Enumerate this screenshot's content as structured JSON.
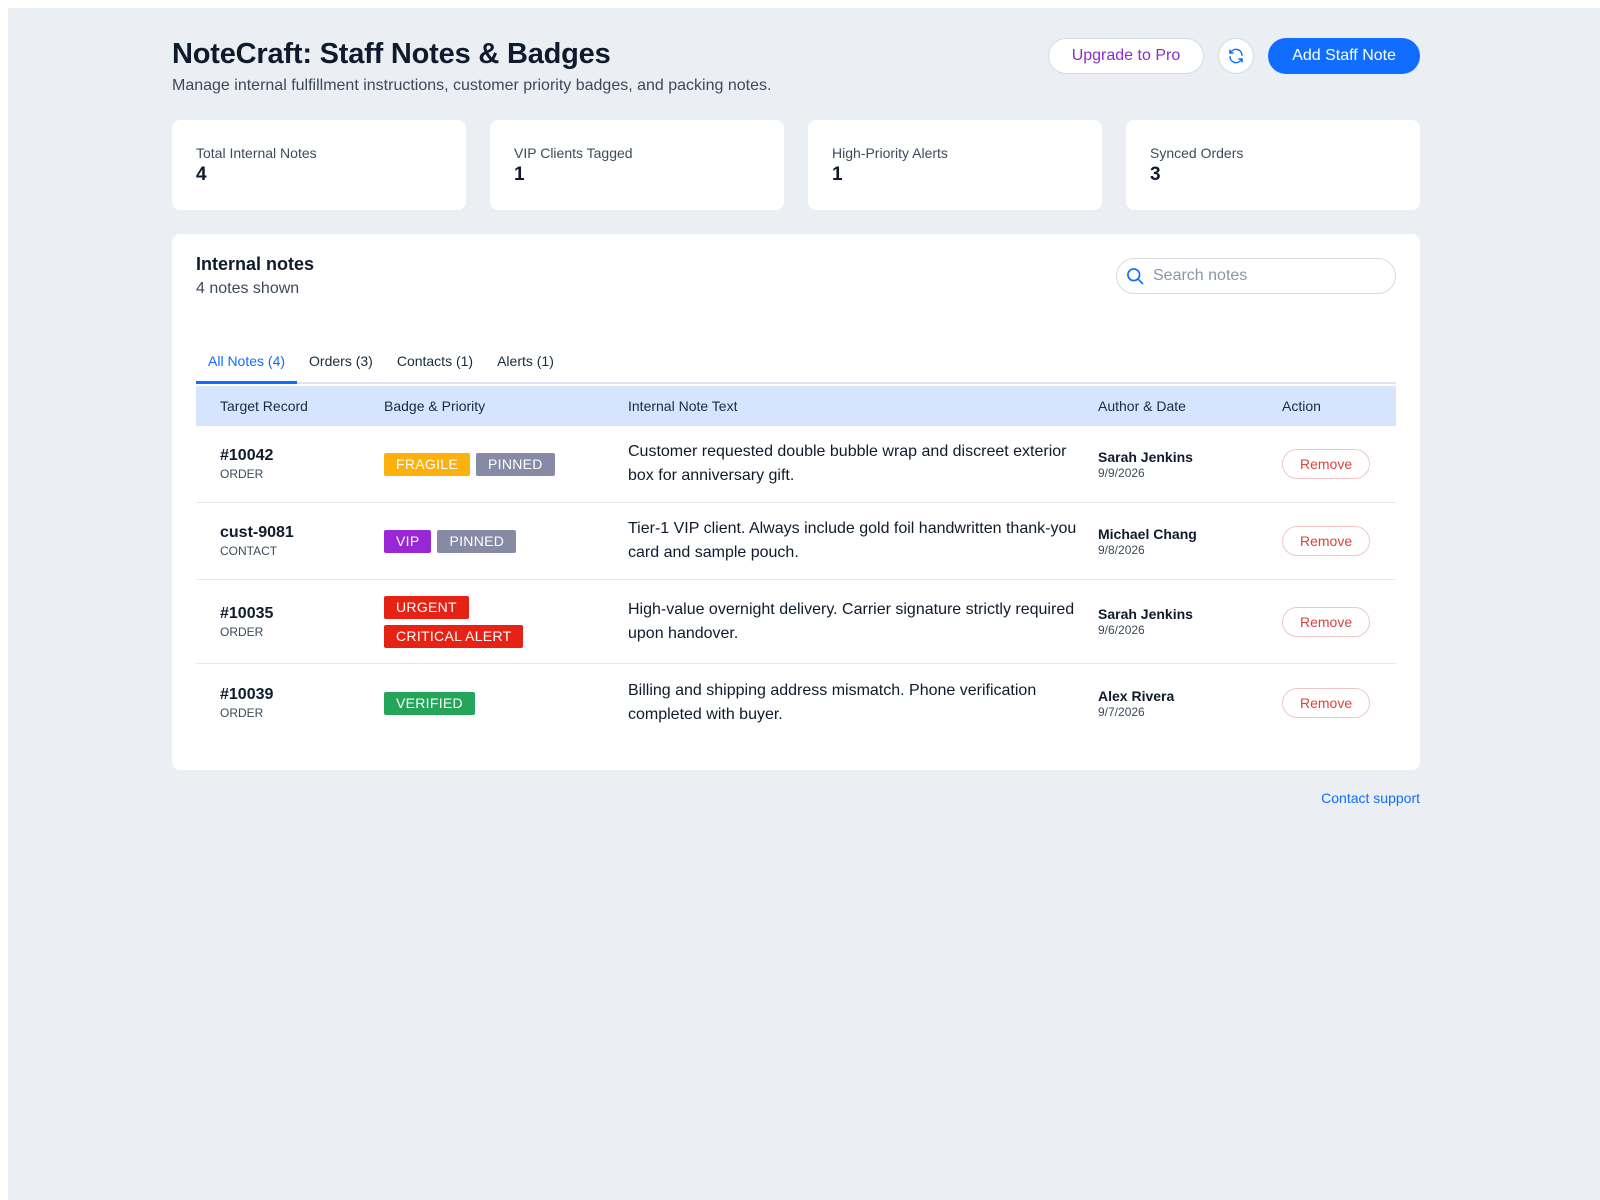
{
  "header": {
    "title": "NoteCraft: Staff Notes & Badges",
    "subtitle": "Manage internal fulfillment instructions, customer priority badges, and packing notes.",
    "upgrade_label": "Upgrade to Pro",
    "refresh_icon": "refresh-icon",
    "add_label": "Add Staff Note"
  },
  "stats": [
    {
      "label": "Total Internal Notes",
      "value": "4"
    },
    {
      "label": "VIP Clients Tagged",
      "value": "1"
    },
    {
      "label": "High-Priority Alerts",
      "value": "1"
    },
    {
      "label": "Synced Orders",
      "value": "3"
    }
  ],
  "panel": {
    "title": "Internal notes",
    "count": "4 notes shown",
    "search_placeholder": "Search notes",
    "search_icon": "search-icon"
  },
  "tabs": [
    {
      "label": "All Notes (4)",
      "active": true
    },
    {
      "label": "Orders (3)",
      "active": false
    },
    {
      "label": "Contacts (1)",
      "active": false
    },
    {
      "label": "Alerts (1)",
      "active": false
    }
  ],
  "table": {
    "columns": [
      "Target Record",
      "Badge & Priority",
      "Internal Note Text",
      "Author & Date",
      "Action"
    ],
    "rows": [
      {
        "id": "#10042",
        "type": "ORDER",
        "badges": [
          {
            "label": "FRAGILE",
            "color": "#fdb10c"
          },
          {
            "label": "PINNED",
            "color": "#868aa5"
          }
        ],
        "note": "Customer requested double bubble wrap and discreet exterior box for anniversary gift.",
        "author": "Sarah Jenkins",
        "date": "9/9/2026",
        "action": "Remove"
      },
      {
        "id": "cust-9081",
        "type": "CONTACT",
        "badges": [
          {
            "label": "VIP",
            "color": "#9a27d5"
          },
          {
            "label": "PINNED",
            "color": "#868aa5"
          }
        ],
        "note": "Tier-1 VIP client. Always include gold foil handwritten thank-you card and sample pouch.",
        "author": "Michael Chang",
        "date": "9/8/2026",
        "action": "Remove"
      },
      {
        "id": "#10035",
        "type": "ORDER",
        "badges": [
          {
            "label": "URGENT",
            "color": "#e62214"
          },
          {
            "label": "CRITICAL ALERT",
            "color": "#e62214"
          }
        ],
        "note": "High-value overnight delivery. Carrier signature strictly required upon handover.",
        "author": "Sarah Jenkins",
        "date": "9/6/2026",
        "action": "Remove"
      },
      {
        "id": "#10039",
        "type": "ORDER",
        "badges": [
          {
            "label": "VERIFIED",
            "color": "#25a55a"
          }
        ],
        "note": "Billing and shipping address mismatch. Phone verification completed with buyer.",
        "author": "Alex Rivera",
        "date": "9/7/2026",
        "action": "Remove"
      }
    ]
  },
  "footer": {
    "support_label": "Contact support"
  },
  "colors": {
    "accent": "#116dff",
    "pro": "#8a2ec9",
    "remove": "#d6453d",
    "header_row": "#d6e5fd"
  }
}
